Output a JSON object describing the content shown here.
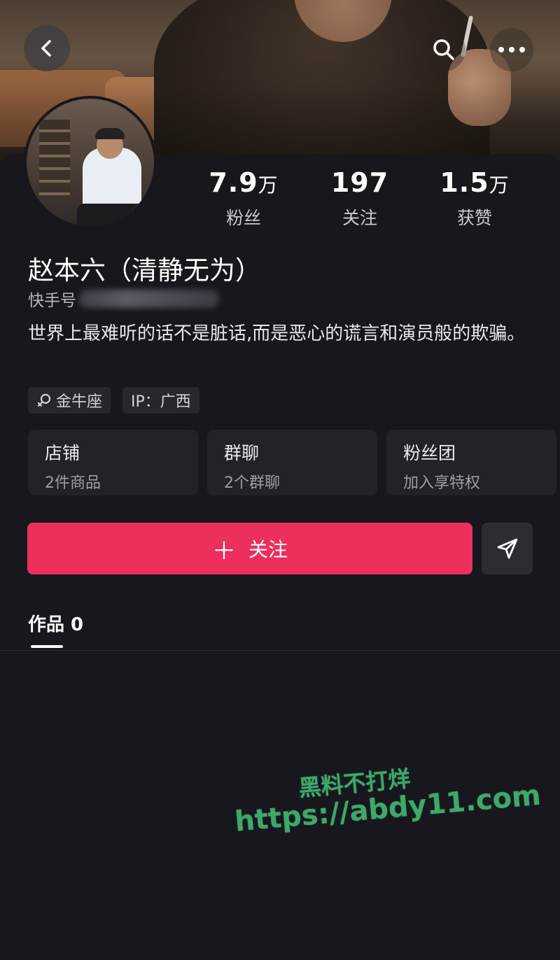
{
  "header": {
    "back_icon": "chevron-left-icon",
    "search_icon": "search-icon",
    "more_icon": "more-dots-icon"
  },
  "profile": {
    "name": "赵本六（清静无为）",
    "id_label": "快手号",
    "bio": "世界上最难听的话不是脏话,而是恶心的谎言和演员般的欺骗。",
    "stats": [
      {
        "num": "7.9",
        "unit": "万",
        "label": "粉丝"
      },
      {
        "num": "197",
        "unit": "",
        "label": "关注"
      },
      {
        "num": "1.5",
        "unit": "万",
        "label": "获赞"
      }
    ],
    "tags": [
      {
        "icon": "zodiac-female-icon",
        "label": "金牛座"
      },
      {
        "icon": "",
        "label": "IP：广西"
      }
    ]
  },
  "cards": [
    {
      "title": "店铺",
      "sub": "2件商品"
    },
    {
      "title": "群聊",
      "sub": "2个群聊"
    },
    {
      "title": "粉丝团",
      "sub": "加入享特权"
    }
  ],
  "actions": {
    "follow_label": "关注",
    "follow_color": "#ec2f5c",
    "share_icon": "send-icon"
  },
  "tabs": {
    "works_label": "作品 0"
  },
  "watermark": {
    "line1": "黑料不打烊",
    "line2": "https://abdy11.com"
  }
}
